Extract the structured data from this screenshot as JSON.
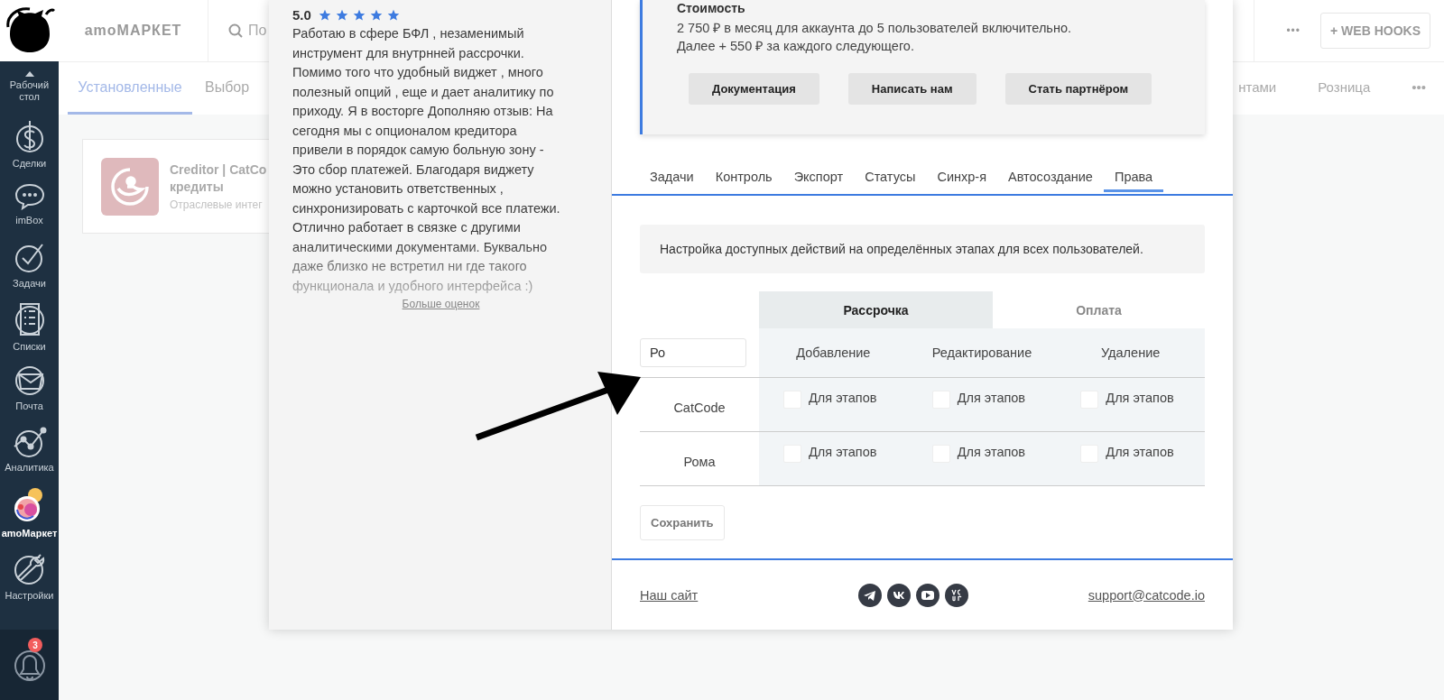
{
  "sidebar": {
    "items": [
      {
        "label": "Рабочий стол",
        "selected": false
      },
      {
        "label": "Сделки",
        "selected": false
      },
      {
        "label": "imBox",
        "selected": false
      },
      {
        "label": "Задачи",
        "selected": false
      },
      {
        "label": "Списки",
        "selected": false
      },
      {
        "label": "Почта",
        "selected": false
      },
      {
        "label": "Аналитика",
        "selected": false
      },
      {
        "label": "amoМаркет",
        "selected": true
      },
      {
        "label": "Настройки",
        "selected": false
      }
    ],
    "notifications": {
      "badge": "3"
    }
  },
  "topbar": {
    "title": "amoМАРКЕТ",
    "search": {
      "placeholder": "По"
    },
    "more": "•••",
    "webhooks_button": "+ WEB HOOKS"
  },
  "market_tabs": [
    {
      "label": "Установленные",
      "selected": true
    },
    {
      "label": "Выбор",
      "selected": false
    },
    {
      "label": "нтами",
      "selected": false
    },
    {
      "label": "Розница",
      "selected": false
    },
    {
      "label": "•••",
      "selected": false
    }
  ],
  "widget_card": {
    "title_lines": [
      "Creditor | CatCo",
      "кредиты"
    ],
    "category": "Отраслевые интег"
  },
  "review": {
    "rating": "5.0",
    "stars": 5,
    "text_lines": [
      "Работаю в сфере БФЛ , незаменимый",
      "инструмент для внутрнней рассрочки.",
      "Помимо того что удобный виджет , много",
      "полезный опций , еще и дает аналитику по",
      "приходу. Я в восторге Дополняю отзыв: На",
      "сегодня мы с опционалом кредитора",
      "привели в порядок самую больную зону -",
      "Это сбор платежей. Благодаря виджету",
      "можно установить ответственных ,",
      "синхронизировать с карточкой все платежи.",
      "Отлично работает в связке с другими",
      "аналитическими документами. Буквально",
      "даже близко не встретил ни где такого",
      "функционала и удобного интерфейса :)"
    ],
    "more_link": "Больше оценок"
  },
  "pricing": {
    "heading": "Стоимость",
    "lines": [
      "2 750 ₽ в месяц для аккаунта до 5 пользователей включительно.",
      "Далее + 550 ₽ за каждого следующего."
    ],
    "buttons": [
      "Документация",
      "Написать нам",
      "Стать партнёром"
    ]
  },
  "settings_tabs": [
    {
      "label": "Задачи",
      "selected": false
    },
    {
      "label": "Контроль",
      "selected": false
    },
    {
      "label": "Экспорт",
      "selected": false
    },
    {
      "label": "Статусы",
      "selected": false
    },
    {
      "label": "Синхр-я",
      "selected": false
    },
    {
      "label": "Автосоздание",
      "selected": false
    },
    {
      "label": "Права",
      "selected": true
    }
  ],
  "info": "Настройка доступных действий на определённых этапах для всех пользователей.",
  "permissions": {
    "sections": [
      {
        "label": "Рассрочка",
        "selected": true
      },
      {
        "label": "Оплата",
        "selected": false
      }
    ],
    "filter": {
      "value": "Ро"
    },
    "columns": [
      "Добавление",
      "Редактирование",
      "Удаление"
    ],
    "rows": [
      {
        "user": "CatCode",
        "cells": [
          {
            "label": "Для этапов",
            "checked": false
          },
          {
            "label": "Для этапов",
            "checked": false
          },
          {
            "label": "Для этапов",
            "checked": false
          }
        ]
      },
      {
        "user": "Рома",
        "cells": [
          {
            "label": "Для этапов",
            "checked": false
          },
          {
            "label": "Для этапов",
            "checked": false
          },
          {
            "label": "Для этапов",
            "checked": false
          }
        ]
      }
    ],
    "save_button": "Сохранить"
  },
  "footer": {
    "site_link": "Наш сайт",
    "email_link": "support@catcode.io"
  }
}
